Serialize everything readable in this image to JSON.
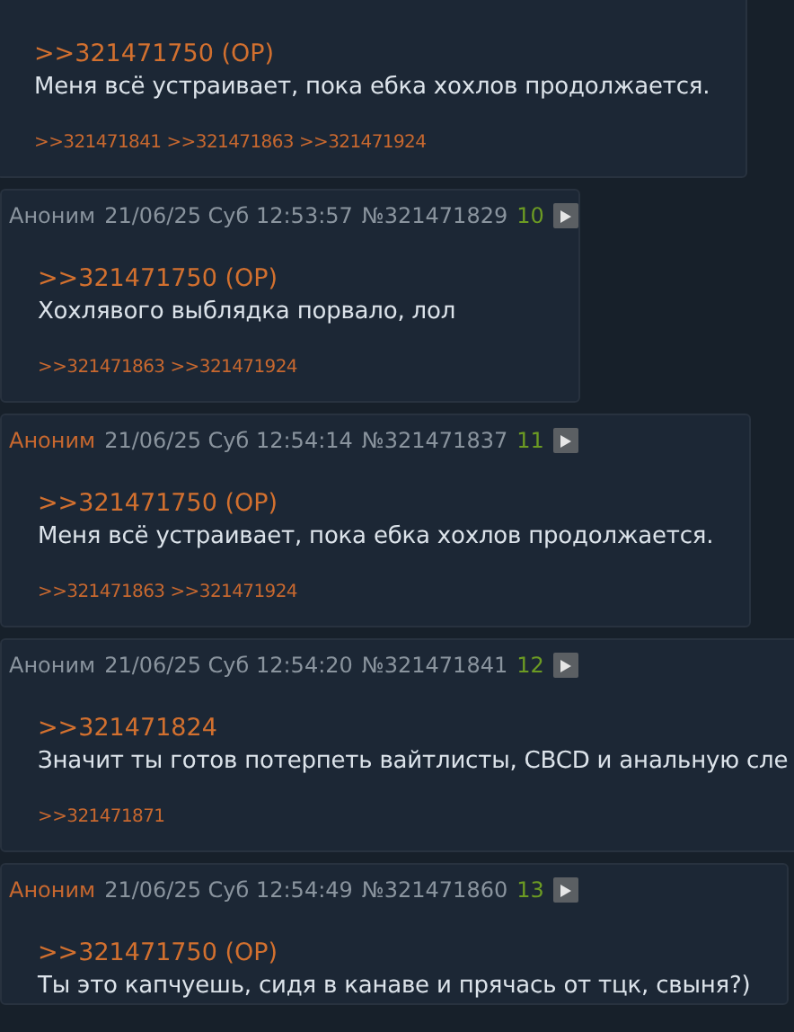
{
  "posts": [
    {
      "reply_to": ">>321471750 (OP)",
      "text": "Меня всё устраивает, пока ебка хохлов продолжается.",
      "replies": [
        ">>321471841",
        ">>321471863",
        ">>321471924"
      ]
    },
    {
      "header": {
        "author": "Аноним",
        "color": "#8a949e",
        "date": "21/06/25 Суб 12:53:57",
        "number": "№321471829",
        "index": "10"
      },
      "reply_to": ">>321471750 (OP)",
      "text": "Хохлявого выблядка порвало, лол",
      "replies": [
        ">>321471863",
        ">>321471924"
      ]
    },
    {
      "header": {
        "author": "Аноним",
        "color": "#c8682f",
        "date": "21/06/25 Суб 12:54:14",
        "number": "№321471837",
        "index": "11"
      },
      "reply_to": ">>321471750 (OP)",
      "text": "Меня всё устраивает, пока ебка хохлов продолжается.",
      "replies": [
        ">>321471863",
        ">>321471924"
      ]
    },
    {
      "header": {
        "author": "Аноним",
        "color": "#8a949e",
        "date": "21/06/25 Суб 12:54:20",
        "number": "№321471841",
        "index": "12"
      },
      "reply_to": ">>321471824",
      "text": "Значит ты готов потерпеть вайтлисты, CBCD и анальную сле",
      "replies": [
        ">>321471871"
      ]
    },
    {
      "header": {
        "author": "Аноним",
        "color": "#c8682f",
        "date": "21/06/25 Суб 12:54:49",
        "number": "№321471860",
        "index": "13"
      },
      "reply_to": ">>321471750 (OP)",
      "text": "Ты это капчуешь, сидя в канаве и прячась от тцк, свыня?)"
    }
  ]
}
